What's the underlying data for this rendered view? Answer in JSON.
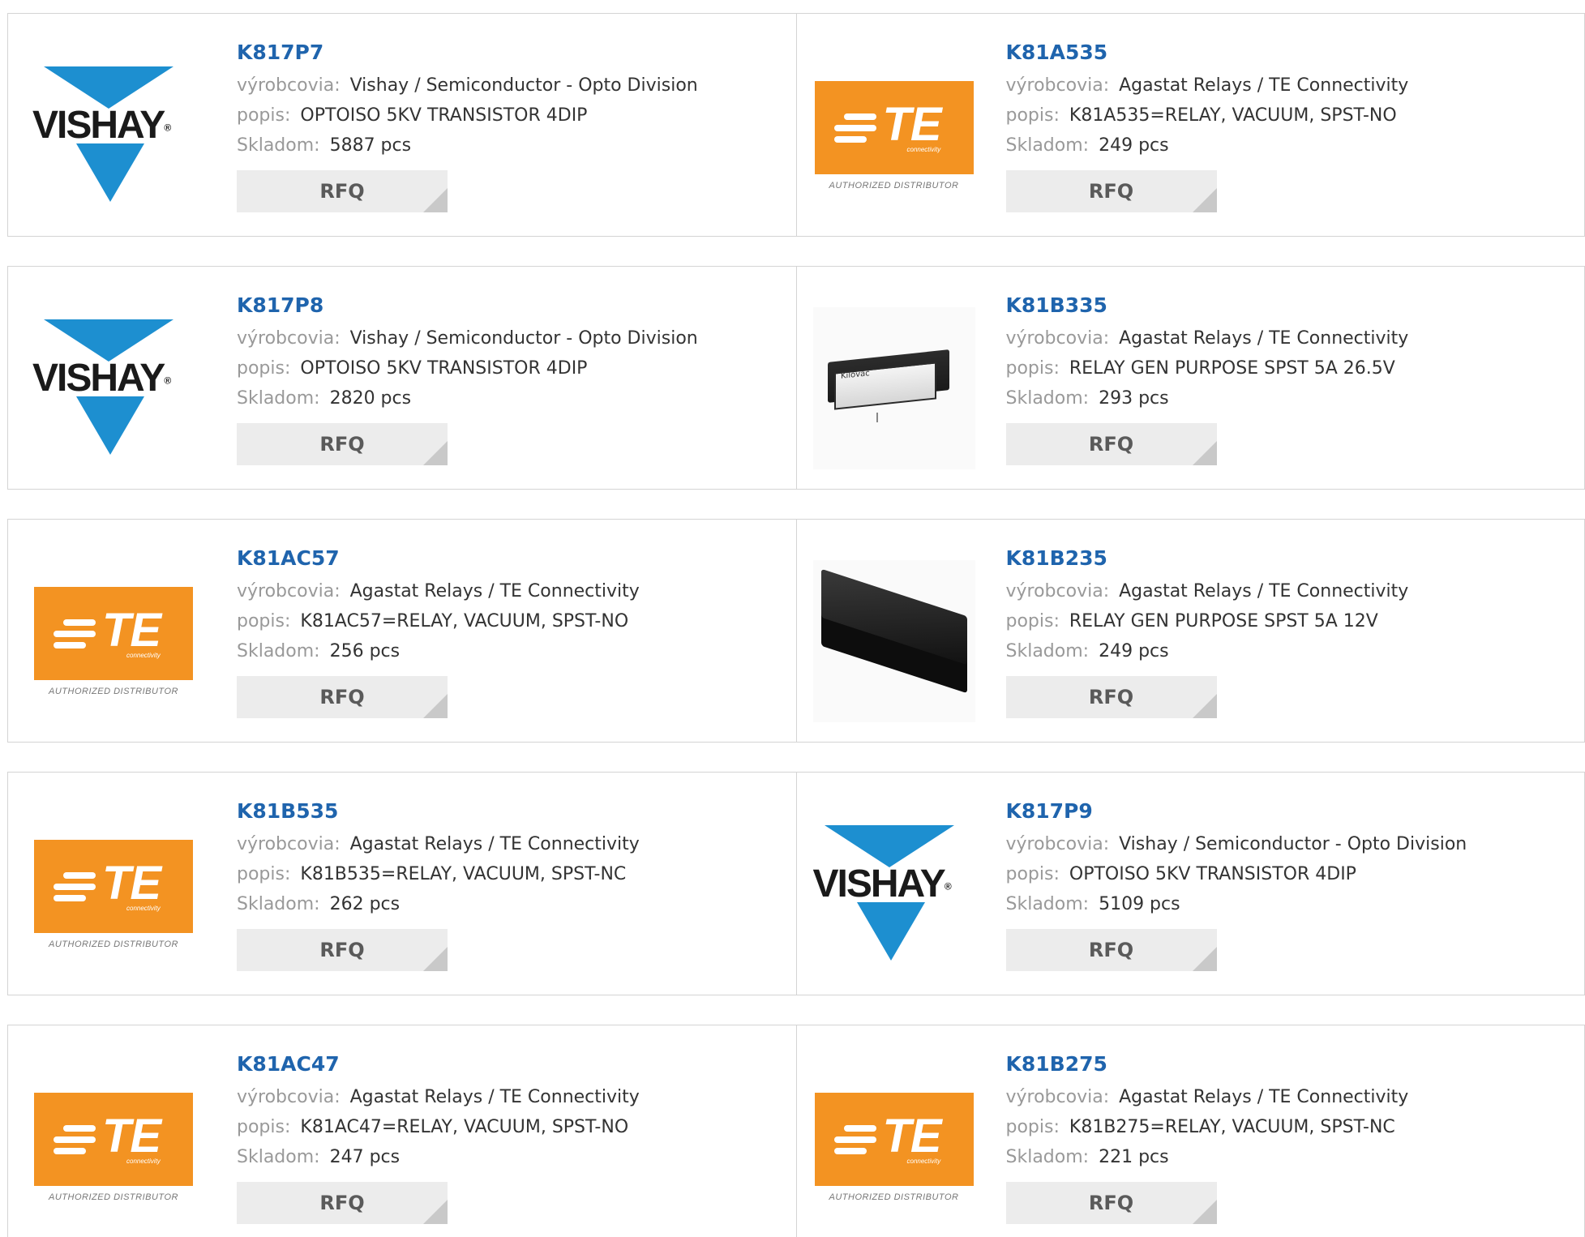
{
  "labels": {
    "manufacturer": "výrobcovia:",
    "description": "popis:",
    "stock": "Skladom:",
    "rfq": "RFQ"
  },
  "logos": {
    "vishay_text": "VISHAY",
    "vishay_reg": "®",
    "te_text": "TE",
    "te_sub": "connectivity",
    "te_authorized": "AUTHORIZED DISTRIBUTOR",
    "kilovac_label": "Kilovac"
  },
  "colors": {
    "part_link": "#1f64ad",
    "vishay_blue": "#1d8fd0",
    "te_orange": "#f39322",
    "rfq_bg": "#ececec"
  },
  "products": [
    {
      "part": "K817P7",
      "manufacturer": "Vishay / Semiconductor - Opto Division",
      "description": "OPTOISO 5KV TRANSISTOR 4DIP",
      "stock": "5887 pcs",
      "logo": "vishay-logo"
    },
    {
      "part": "K81A535",
      "manufacturer": "Agastat Relays / TE Connectivity",
      "description": "K81A535=RELAY, VACUUM, SPST-NO",
      "stock": "249 pcs",
      "logo": "te-logo"
    },
    {
      "part": "K817P8",
      "manufacturer": "Vishay / Semiconductor - Opto Division",
      "description": "OPTOISO 5KV TRANSISTOR 4DIP",
      "stock": "2820 pcs",
      "logo": "vishay-logo"
    },
    {
      "part": "K81B335",
      "manufacturer": "Agastat Relays / TE Connectivity",
      "description": "RELAY GEN PURPOSE SPST 5A 26.5V",
      "stock": "293 pcs",
      "logo": "kilovac-relay-photo"
    },
    {
      "part": "K81AC57",
      "manufacturer": "Agastat Relays / TE Connectivity",
      "description": "K81AC57=RELAY, VACUUM, SPST-NO",
      "stock": "256 pcs",
      "logo": "te-logo"
    },
    {
      "part": "K81B235",
      "manufacturer": "Agastat Relays / TE Connectivity",
      "description": "RELAY GEN PURPOSE SPST 5A 12V",
      "stock": "249 pcs",
      "logo": "black-relay-photo"
    },
    {
      "part": "K81B535",
      "manufacturer": "Agastat Relays / TE Connectivity",
      "description": "K81B535=RELAY, VACUUM, SPST-NC",
      "stock": "262 pcs",
      "logo": "te-logo"
    },
    {
      "part": "K817P9",
      "manufacturer": "Vishay / Semiconductor - Opto Division",
      "description": "OPTOISO 5KV TRANSISTOR 4DIP",
      "stock": "5109 pcs",
      "logo": "vishay-logo"
    },
    {
      "part": "K81AC47",
      "manufacturer": "Agastat Relays / TE Connectivity",
      "description": "K81AC47=RELAY, VACUUM, SPST-NO",
      "stock": "247 pcs",
      "logo": "te-logo"
    },
    {
      "part": "K81B275",
      "manufacturer": "Agastat Relays / TE Connectivity",
      "description": "K81B275=RELAY, VACUUM, SPST-NC",
      "stock": "221 pcs",
      "logo": "te-logo"
    }
  ]
}
